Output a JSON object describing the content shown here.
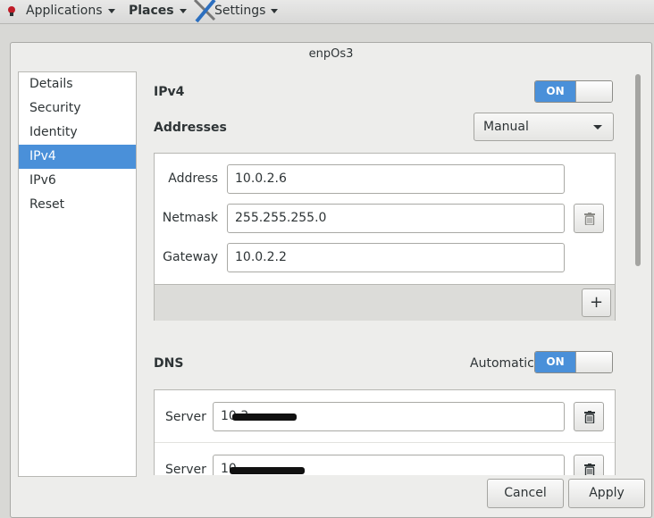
{
  "topbar": {
    "applications": "Applications",
    "places": "Places",
    "settings": "Settings"
  },
  "dialog": {
    "title": "enpOs3"
  },
  "sidebar": {
    "items": [
      {
        "label": "Details"
      },
      {
        "label": "Security"
      },
      {
        "label": "Identity"
      },
      {
        "label": "IPv4",
        "selected": true
      },
      {
        "label": "IPv6"
      },
      {
        "label": "Reset"
      }
    ]
  },
  "ipv4": {
    "title": "IPv4",
    "switch": "ON",
    "addresses_label": "Addresses",
    "method": "Manual",
    "fields": {
      "address_label": "Address",
      "address_value": "10.0.2.6",
      "netmask_label": "Netmask",
      "netmask_value": "255.255.255.0",
      "gateway_label": "Gateway",
      "gateway_value": "10.0.2.2"
    },
    "add_label": "+"
  },
  "dns": {
    "title": "DNS",
    "automatic_label": "Automatic",
    "switch": "ON",
    "servers": [
      {
        "label": "Server",
        "value": "10.3"
      },
      {
        "label": "Server",
        "value": "10."
      }
    ]
  },
  "buttons": {
    "cancel": "Cancel",
    "apply": "Apply"
  },
  "colors": {
    "accent": "#4a90d9"
  }
}
